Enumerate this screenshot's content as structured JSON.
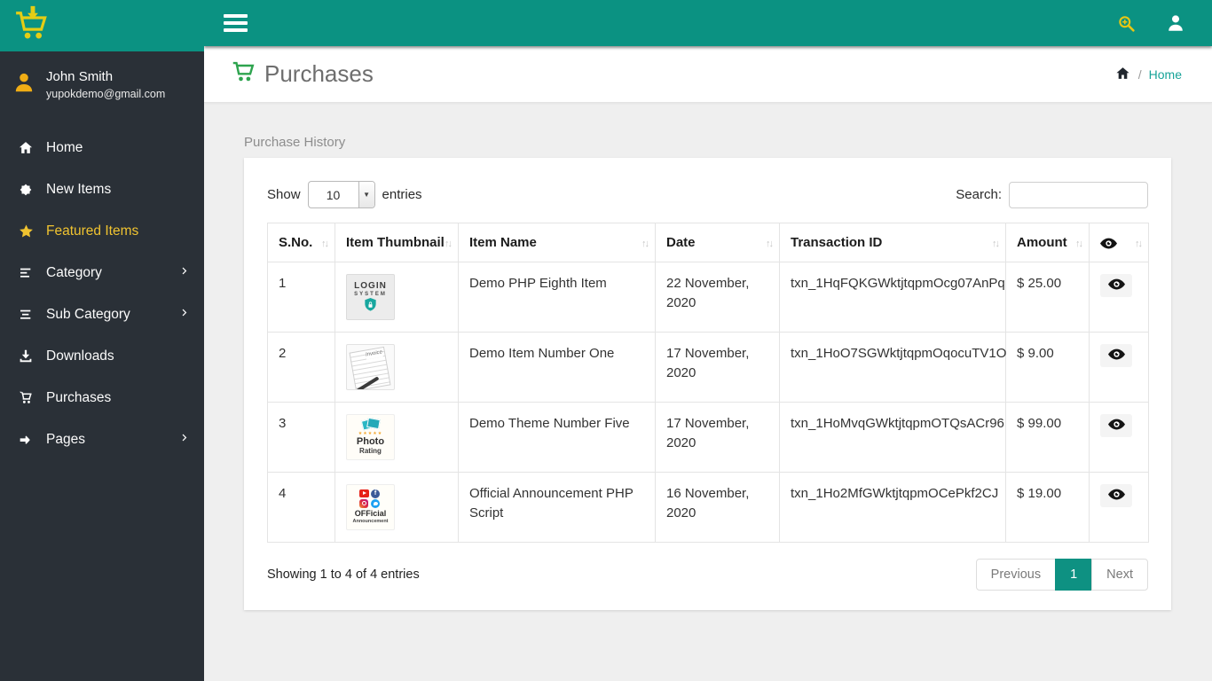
{
  "theme": {
    "teal": "#0b9282",
    "sidebar_bg": "#2a3037",
    "accent_yellow": "#f0c330",
    "logo_yellow": "#e4cd15",
    "avatar_yellow": "#f0ad15",
    "title_green": "#2ea44f",
    "breadcrumb_link": "#17a398",
    "pagination_active": "#0e9182"
  },
  "topbar": {
    "hamburger_icon": "hamburger-icon",
    "search_icon": "search-plus-icon",
    "user_icon": "user-icon"
  },
  "sidebar": {
    "logo_icon": "cart-download-icon",
    "user": {
      "name": "John Smith",
      "email": "yupokdemo@gmail.com"
    },
    "items": [
      {
        "label": "Home",
        "icon": "home",
        "active": false,
        "has_submenu": false
      },
      {
        "label": "New Items",
        "icon": "burst",
        "active": false,
        "has_submenu": false
      },
      {
        "label": "Featured Items",
        "icon": "star",
        "active": true,
        "has_submenu": false
      },
      {
        "label": "Category",
        "icon": "list",
        "active": false,
        "has_submenu": true
      },
      {
        "label": "Sub Category",
        "icon": "list-alt",
        "active": false,
        "has_submenu": true
      },
      {
        "label": "Downloads",
        "icon": "download",
        "active": false,
        "has_submenu": false
      },
      {
        "label": "Purchases",
        "icon": "cart",
        "active": false,
        "has_submenu": false
      },
      {
        "label": "Pages",
        "icon": "hand",
        "active": false,
        "has_submenu": true
      }
    ]
  },
  "page_header": {
    "title": "Purchases",
    "title_icon": "cart-icon",
    "breadcrumb": {
      "home_icon": "home-icon",
      "separator": "/",
      "link": "Home"
    }
  },
  "panel": {
    "heading": "Purchase History",
    "show_label": "Show",
    "page_length": "10",
    "entries_label": "entries",
    "search_label": "Search:",
    "search_value": "",
    "table": {
      "columns": [
        {
          "label": "S.No.",
          "sortable": true
        },
        {
          "label": "Item Thumbnail",
          "sortable": true
        },
        {
          "label": "Item Name",
          "sortable": true
        },
        {
          "label": "Date",
          "sortable": true
        },
        {
          "label": "Transaction ID",
          "sortable": true
        },
        {
          "label": "Amount",
          "sortable": true
        },
        {
          "label": "",
          "icon": "eye",
          "sortable": true
        }
      ],
      "rows": [
        {
          "sno": "1",
          "thumbnail": {
            "kind": "login-system",
            "text1": "LOGIN",
            "text2": "SYSTEM"
          },
          "item_name": "Demo PHP Eighth Item",
          "date": "22 November, 2020",
          "transaction_id": "txn_1HqFQKGWktjtqpmOcg07AnPq",
          "amount": "$ 25.00"
        },
        {
          "sno": "2",
          "thumbnail": {
            "kind": "invoice",
            "text1": "Invoice"
          },
          "item_name": "Demo Item Number One",
          "date": "17 November, 2020",
          "transaction_id": "txn_1HoO7SGWktjtqpmOqocuTV1O",
          "amount": "$ 9.00"
        },
        {
          "sno": "3",
          "thumbnail": {
            "kind": "photo-rating",
            "text1": "Photo",
            "text2": "Rating"
          },
          "item_name": "Demo Theme Number Five",
          "date": "17 November, 2020",
          "transaction_id": "txn_1HoMvqGWktjtqpmOTQsACr96",
          "amount": "$ 99.00"
        },
        {
          "sno": "4",
          "thumbnail": {
            "kind": "official-announcement",
            "text1": "OFFicial",
            "text2": "Announcement"
          },
          "item_name": "Official Announcement PHP Script",
          "date": "16 November, 2020",
          "transaction_id": "txn_1Ho2MfGWktjtqpmOCePkf2CJ",
          "amount": "$ 19.00"
        }
      ]
    },
    "footer": {
      "info": "Showing 1 to 4 of 4 entries",
      "pagination": {
        "previous": "Previous",
        "current": "1",
        "next": "Next"
      }
    }
  }
}
